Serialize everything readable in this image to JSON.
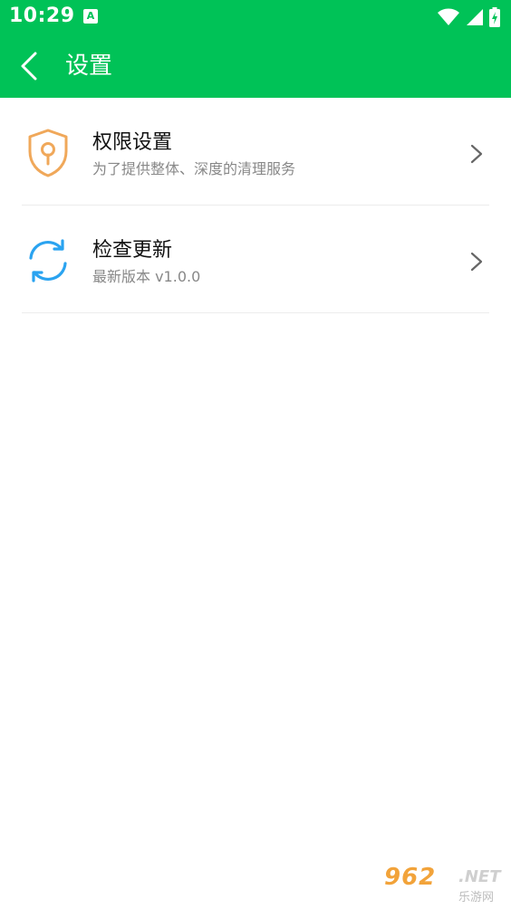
{
  "status_bar": {
    "time": "10:29",
    "notification_glyph": "A",
    "icons": [
      "wifi-icon",
      "signal-icon",
      "battery-charging-icon"
    ]
  },
  "app_bar": {
    "back_icon": "back-arrow-icon",
    "title": "设置"
  },
  "settings": [
    {
      "icon": "shield-lock-icon",
      "label": "权限设置",
      "subtitle": "为了提供整体、深度的清理服务"
    },
    {
      "icon": "refresh-icon",
      "label": "检查更新",
      "subtitle": "最新版本 v1.0.0"
    }
  ],
  "watermark": {
    "main": "962",
    "net": ".NET",
    "sub": "乐游网"
  },
  "colors": {
    "brand": "#00c257",
    "shield": "#f0a85a",
    "refresh": "#2aa3f0"
  }
}
